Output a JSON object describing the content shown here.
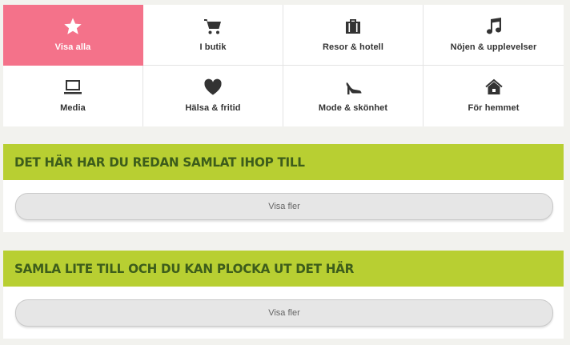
{
  "categories": [
    {
      "label": "Visa alla",
      "icon": "star-icon",
      "active": true
    },
    {
      "label": "I butik",
      "icon": "cart-icon"
    },
    {
      "label": "Resor & hotell",
      "icon": "suitcase-icon"
    },
    {
      "label": "Nöjen & upplevelser",
      "icon": "music-note-icon"
    },
    {
      "label": "Media",
      "icon": "laptop-icon"
    },
    {
      "label": "Hälsa & fritid",
      "icon": "heart-icon"
    },
    {
      "label": "Mode & skönhet",
      "icon": "high-heel-icon"
    },
    {
      "label": "För hemmet",
      "icon": "house-icon"
    }
  ],
  "sections": [
    {
      "title": "DET HÄR HAR DU REDAN SAMLAT IHOP TILL",
      "button_label": "Visa fler"
    },
    {
      "title": "SAMLA LITE TILL OCH DU KAN PLOCKA UT DET HÄR",
      "button_label": "Visa fler"
    }
  ],
  "colors": {
    "active": "#f4728a",
    "section_header": "#b8cf32",
    "section_title": "#3d5d1b"
  }
}
